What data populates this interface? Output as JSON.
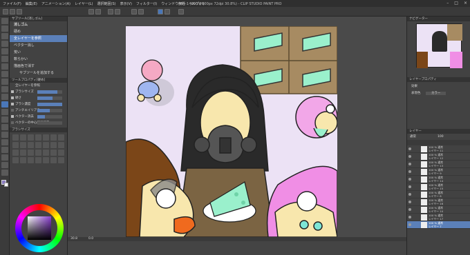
{
  "app": {
    "title": "無題-1 (900 x 900px 72dpi 30.8%) - CLIP STUDIO PAINT PRO",
    "menu": [
      "ファイル(F)",
      "編集(E)",
      "アニメーション(A)",
      "レイヤー(L)",
      "選択範囲(S)",
      "表示(V)",
      "フィルター(I)",
      "ウィンドウ(W)",
      "ヘルプ(H)"
    ]
  },
  "subtool_panel": {
    "header": "サブツール[消しゴム]",
    "group": "消しゴム",
    "items": [
      "硬め",
      "全レイヤーを参照",
      "ベクター消し",
      "荒い",
      "軟らかい",
      "描画色で消す"
    ],
    "selected_index": 1,
    "add_label": "サブツールを追加する"
  },
  "tool_property": {
    "header": "ツールプロパティ[硬め]",
    "sub_header": "全レイヤーを参照",
    "rows": [
      {
        "label": "ブラシサイズ",
        "on": true,
        "value": 0.8
      },
      {
        "label": "硬さ",
        "on": true,
        "value": 0.6
      },
      {
        "label": "ブラシ濃度",
        "on": true,
        "value": 1.0
      },
      {
        "label": "アンチエイリアス",
        "on": false,
        "value": 0.5
      },
      {
        "label": "ベクター消去",
        "on": true,
        "value": 0.3
      },
      {
        "label": "ベクターの中心線で消去",
        "on": false,
        "value": 0.0
      }
    ]
  },
  "brush_size_panel": {
    "header": "ブラシサイズ"
  },
  "color_panel": {
    "label": "カラーサークル"
  },
  "status": {
    "zoom": "30.8",
    "angle": "0.0"
  },
  "navigator": {
    "header": "ナビゲーター"
  },
  "layer_property": {
    "header": "レイヤープロパティ",
    "effect_label": "効果",
    "expression_label": "表現色",
    "expression_value": "カラー"
  },
  "layers_panel": {
    "header": "レイヤー",
    "blend": "通常",
    "opacity": "100",
    "layers": [
      {
        "name": "レイヤー 11",
        "mode": "100 % 通常"
      },
      {
        "name": "レイヤー 12",
        "mode": "100 % 通常"
      },
      {
        "name": "レイヤー 13",
        "mode": "100 % 通常"
      },
      {
        "name": "レイヤー 9",
        "mode": "100 % 通常"
      },
      {
        "name": "レイヤー 14",
        "mode": "100 % 通常"
      },
      {
        "name": "レイヤー 15",
        "mode": "100 % 通常"
      },
      {
        "name": "レイヤー 8",
        "mode": "100 % 通常"
      },
      {
        "name": "レイヤー 16",
        "mode": "100 % 通常"
      },
      {
        "name": "レイヤー 10",
        "mode": "100 % 通常"
      },
      {
        "name": "レイヤー 17",
        "mode": "100 % 通常"
      },
      {
        "name": "レイヤー 7",
        "mode": "100 % 通常"
      }
    ],
    "selected_index": 10
  },
  "colors": {
    "accent": "#5b80b9",
    "bg_lavender": "#ece2f5",
    "box_brown": "#a78b62",
    "cake_mint": "#9af0cc",
    "hair_pink": "#f08ee5",
    "skin": "#f8e7ad"
  }
}
